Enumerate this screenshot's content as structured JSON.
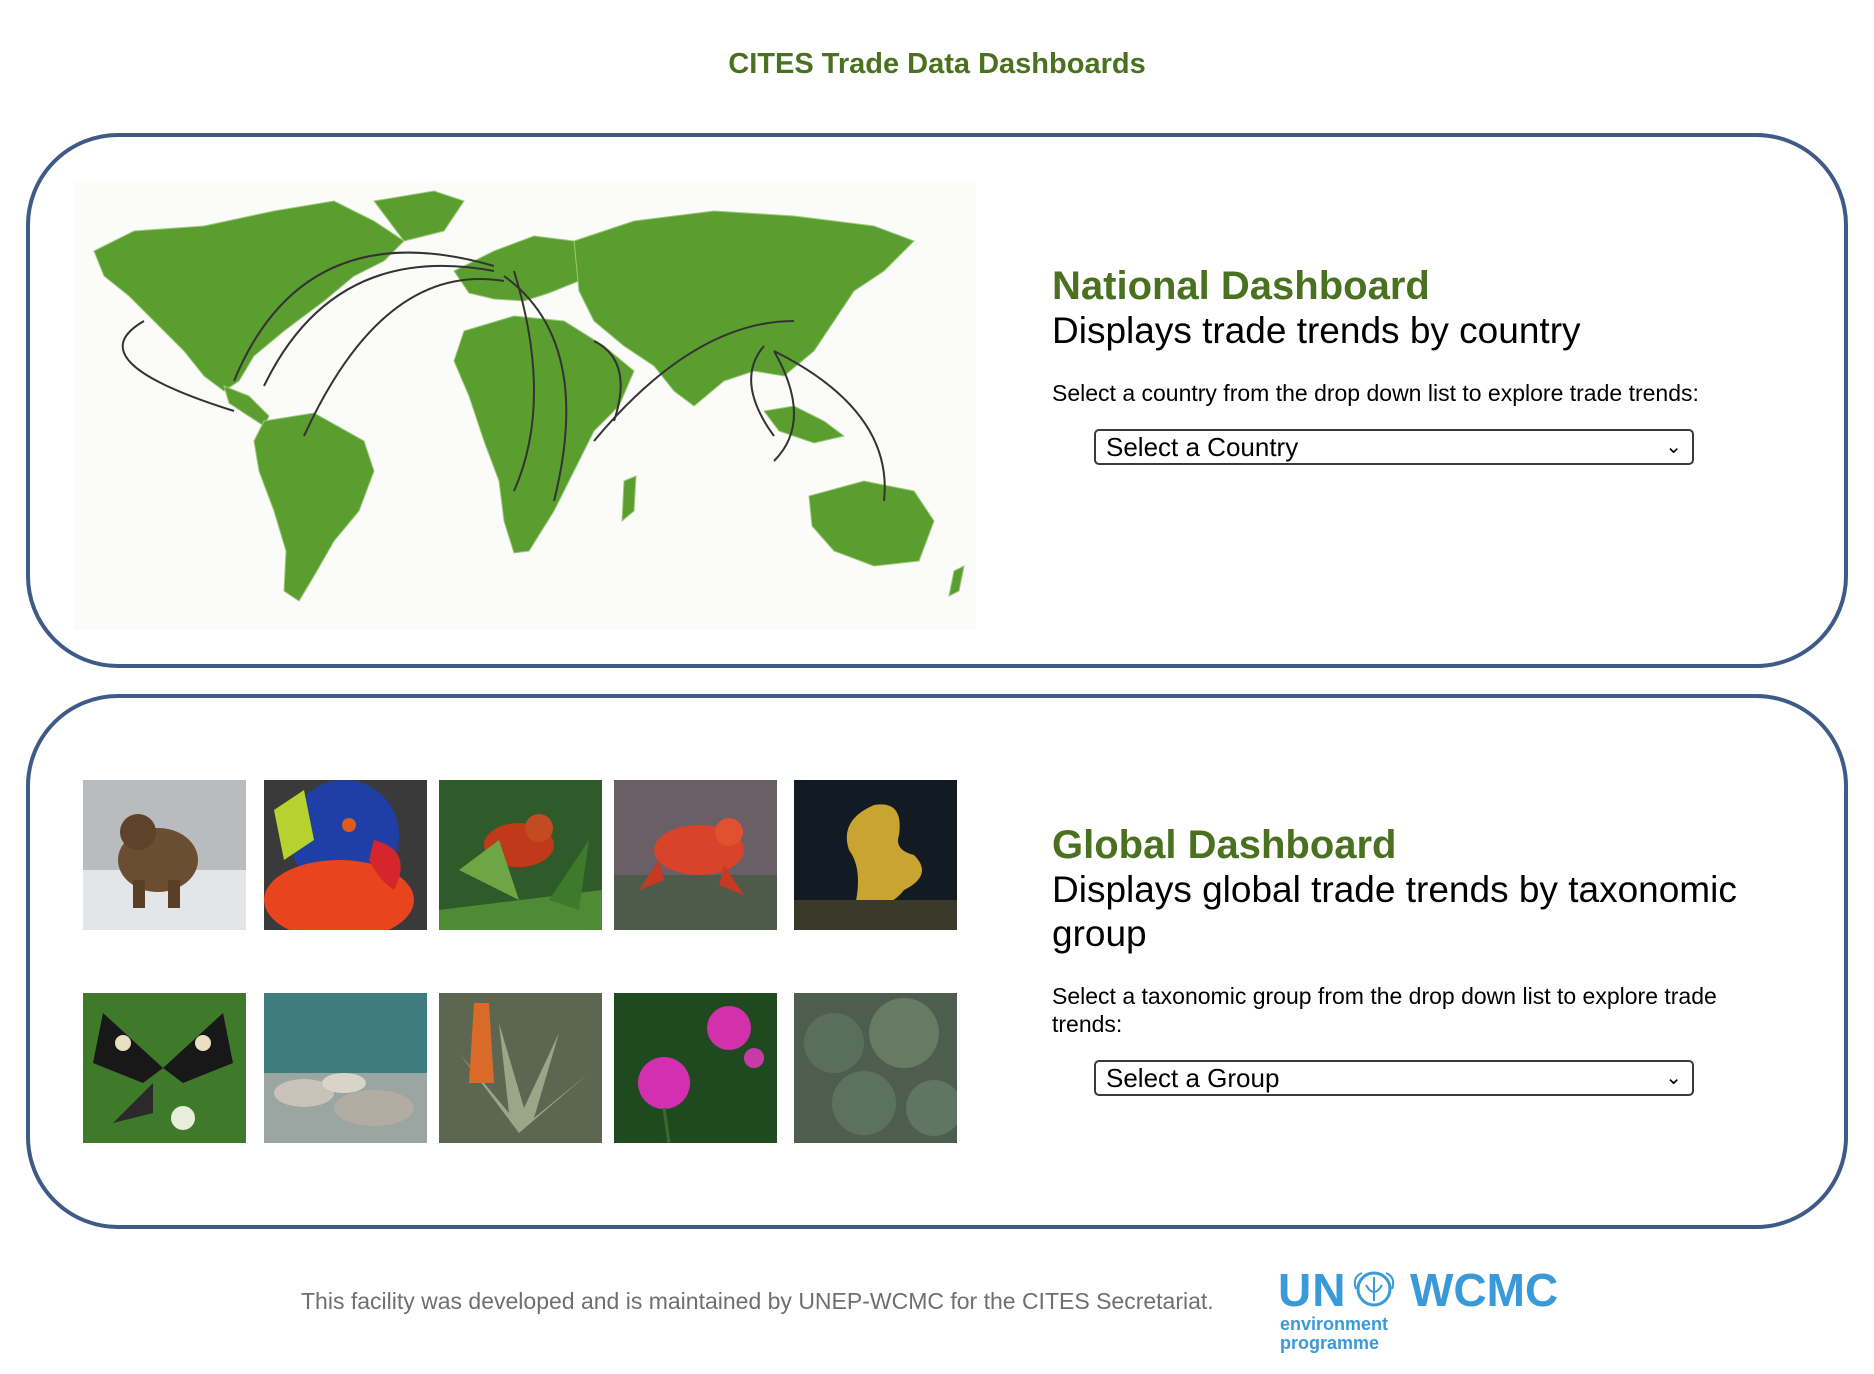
{
  "page": {
    "title": "CITES Trade Data Dashboards"
  },
  "national": {
    "heading": "National Dashboard",
    "subtitle": "Displays trade trends by country",
    "instruction": "Select a country from the drop down list to explore trade trends:",
    "select_value": "Select a Country"
  },
  "global": {
    "heading": "Global Dashboard",
    "subtitle": "Displays global trade trends by taxonomic group",
    "instruction": "Select a taxonomic group from the drop down list to explore trade trends:",
    "select_value": "Select a Group",
    "photos": [
      "bear",
      "lorikeet",
      "chameleon",
      "frog",
      "seahorse",
      "butterfly",
      "coral-reef",
      "aloe-plant",
      "orchid",
      "cactus"
    ]
  },
  "footer": {
    "text": "This facility was developed and is maintained by UNEP-WCMC for the CITES Secretariat.",
    "logo_un": "UN",
    "logo_wcmc": "WCMC",
    "logo_env_line1": "environment",
    "logo_env_line2": "programme"
  },
  "colors": {
    "accent": "#4a7120",
    "border": "#3e5a87",
    "map_green": "#5a9e2f",
    "logo_blue": "#3a9ad9"
  },
  "icons": {
    "select_arrow": "chevron-down-icon",
    "logo_emblem": "unep-emblem-icon"
  }
}
